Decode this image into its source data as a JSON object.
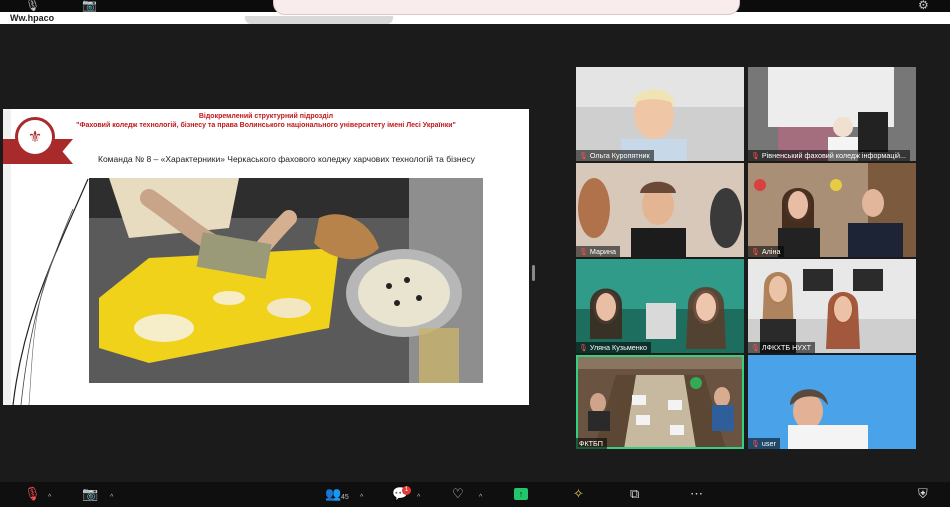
{
  "top": {
    "label": "Ww.hpaco"
  },
  "slide": {
    "logo_glyph": "⚜",
    "title_line1": "Відокремлений структурний підрозділ",
    "title_line2": "\"Фаховий коледж технологій, бізнесу та права Волинського національного університету імені Лесі Українки\"",
    "team_caption": "Команда № 8 – «Характерники» Черкаського фахового коледжу харчових технологій та бізнесу"
  },
  "participants": [
    {
      "name": "Ольга Куропятник",
      "muted": true
    },
    {
      "name": "Рівненський фаховий коледж інформацій...",
      "muted": true
    },
    {
      "name": "Марина",
      "muted": true
    },
    {
      "name": "Аліна",
      "muted": true
    },
    {
      "name": "Уляна Кузьменко",
      "muted": true
    },
    {
      "name": "ЛФКХТБ НУХТ",
      "muted": true
    },
    {
      "name": "ФКТБП",
      "muted": false,
      "active_speaker": true
    },
    {
      "name": "user",
      "muted": true
    }
  ],
  "toolbar": {
    "mic_icon": "microphone-muted-icon",
    "camera_icon": "camera-off-icon",
    "participants_count": "45",
    "chat_badge": "1",
    "caret": "^"
  },
  "colors": {
    "active_border": "#35d07f",
    "share_green": "#22c56b",
    "slide_red": "#c01818",
    "muted_red": "#ff4d4d"
  }
}
